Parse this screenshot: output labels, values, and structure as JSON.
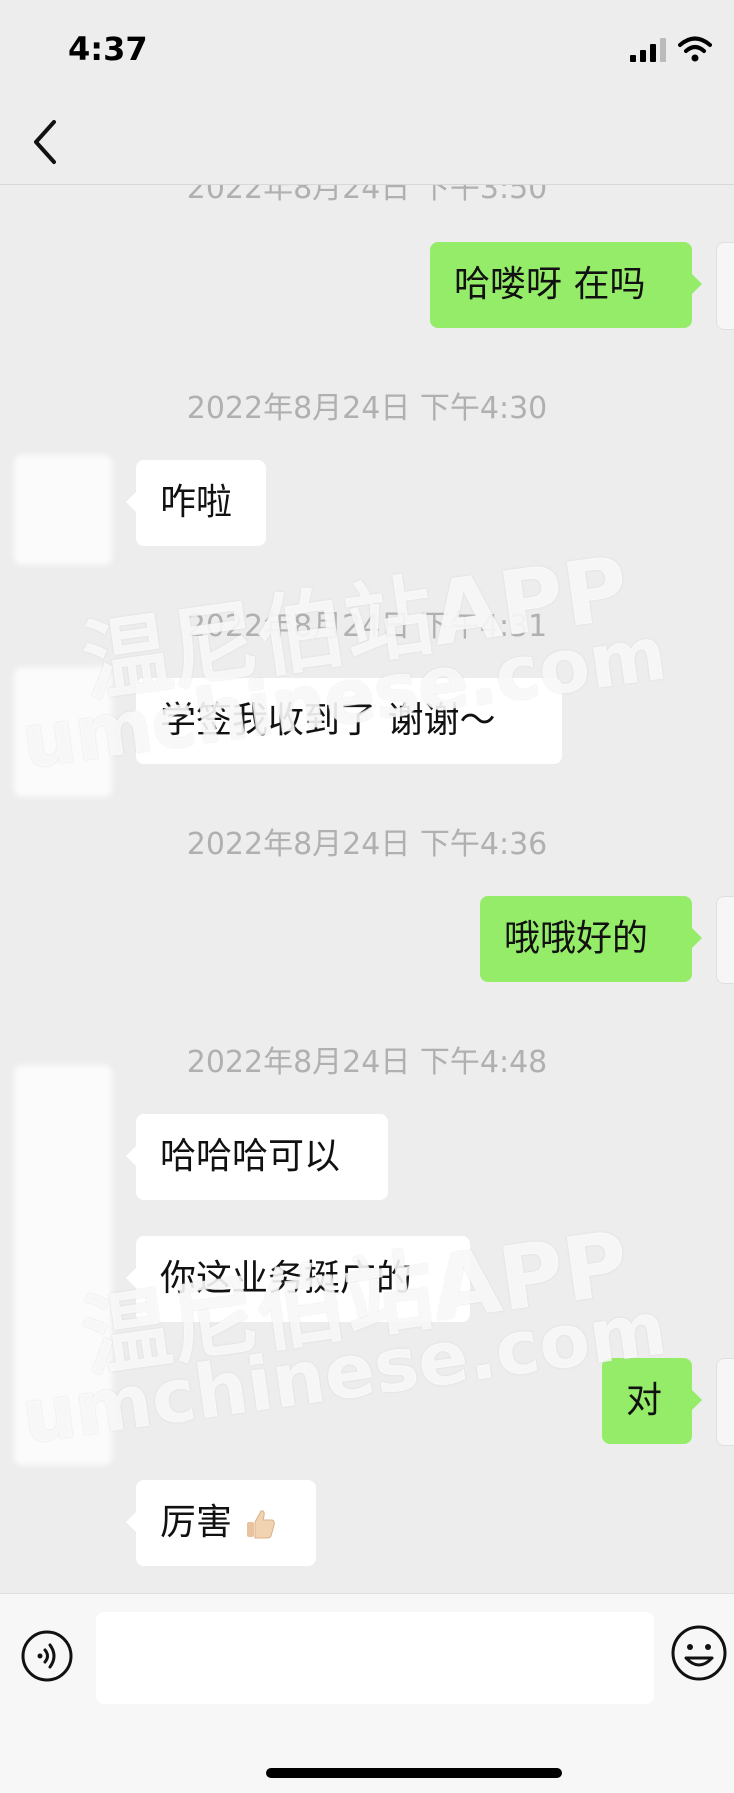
{
  "status_bar": {
    "time": "4:37",
    "signal_icon": "signal-bars-icon",
    "wifi_icon": "wifi-icon"
  },
  "nav": {
    "back_icon": "chevron-left-icon",
    "title": ""
  },
  "timestamps": {
    "t0": "2022年8月24日 下午3:50",
    "t1": "2022年8月24日 下午4:30",
    "t2": "2022年8月24日 下午4:31",
    "t3": "2022年8月24日 下午4:36",
    "t4": "2022年8月24日 下午4:48"
  },
  "messages": {
    "m1": "哈喽呀 在吗",
    "m2": "咋啦",
    "m3": "学签我收到了 谢谢～",
    "m4": "哦哦好的",
    "m5": "哈哈哈可以",
    "m6": "你这业务挺广的",
    "m7": "对",
    "m8": "厉害"
  },
  "watermark": {
    "cn": "温尼伯站APP",
    "url": "umchinese.com"
  },
  "input_bar": {
    "voice_icon": "voice-icon",
    "emoji_icon": "emoji-icon",
    "placeholder": ""
  },
  "colors": {
    "background": "#ededed",
    "outgoing_bubble": "#95ec69",
    "incoming_bubble": "#ffffff",
    "timestamp_text": "#b0b0b0"
  }
}
